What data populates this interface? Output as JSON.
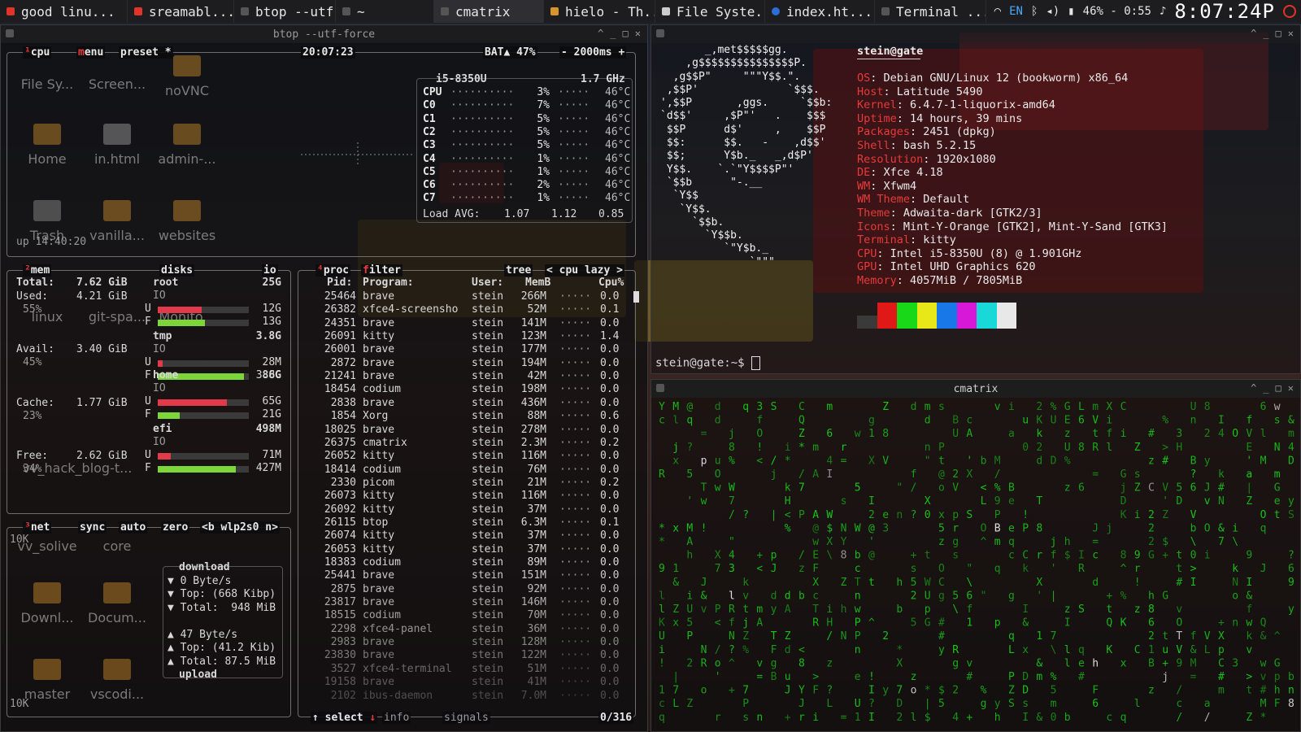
{
  "panel": {
    "tabs": [
      {
        "label": "good linu...",
        "color": "#e0332a"
      },
      {
        "label": "sreamabl...",
        "color": "#e0332a"
      },
      {
        "label": "btop --utf...",
        "color": "#555555"
      },
      {
        "label": "~",
        "color": "#555555"
      },
      {
        "label": "cmatrix",
        "color": "#555555"
      },
      {
        "label": "hielo - Th...",
        "color": "#d8932d"
      },
      {
        "label": "File Syste...",
        "color": "#cccccc"
      },
      {
        "label": "index.ht...",
        "color": "#2b6fd6"
      },
      {
        "label": "Terminal ...",
        "color": "#555555"
      }
    ],
    "keyboard_layout": "EN",
    "battery": "46% - 0:55",
    "clock": "8:07:24P"
  },
  "btop": {
    "window_title": "btop --utf-force",
    "header": {
      "cpu_tab": "cpu",
      "menu": "menu",
      "preset": "preset *",
      "time": "20:07:23",
      "battery": "BAT▲ 47%",
      "interval": "- 2000ms +"
    },
    "cpu": {
      "model": "i5-8350U",
      "freq": "1.7 GHz",
      "rows": [
        {
          "label": "CPU",
          "pct": "3%",
          "temp": "46°C"
        },
        {
          "label": "C0",
          "pct": "7%",
          "temp": "46°C"
        },
        {
          "label": "C1",
          "pct": "5%",
          "temp": "46°C"
        },
        {
          "label": "C2",
          "pct": "5%",
          "temp": "46°C"
        },
        {
          "label": "C3",
          "pct": "5%",
          "temp": "46°C"
        },
        {
          "label": "C4",
          "pct": "1%",
          "temp": "46°C"
        },
        {
          "label": "C5",
          "pct": "1%",
          "temp": "46°C"
        },
        {
          "label": "C6",
          "pct": "2%",
          "temp": "46°C"
        },
        {
          "label": "C7",
          "pct": "1%",
          "temp": "46°C"
        }
      ],
      "load_avg_label": "Load AVG:",
      "load_avg": [
        "1.07",
        "1.12",
        "0.85"
      ],
      "uptime": "up 14:40:20"
    },
    "mem": {
      "title": "mem",
      "disks_title": "disks",
      "io_title": "io",
      "rows": [
        {
          "label": "Total:",
          "value": "7.62 GiB",
          "pct": ""
        },
        {
          "label": "Used:",
          "value": "4.21 GiB",
          "pct": "55%"
        },
        {
          "label": "Avail:",
          "value": "3.40 GiB",
          "pct": "45%"
        },
        {
          "label": "Cache:",
          "value": "1.77 GiB",
          "pct": "23%"
        },
        {
          "label": "Free:",
          "value": "2.62 GiB",
          "pct": "34%"
        }
      ],
      "disks": [
        {
          "name": "root",
          "size": "25G",
          "used": "12G",
          "free": "13G",
          "used_frac": 0.48,
          "free_frac": 0.52
        },
        {
          "name": "tmp",
          "size": "3.8G",
          "used": "28M",
          "free": "3.8G",
          "used_frac": 0.05,
          "free_frac": 0.95
        },
        {
          "name": "home",
          "size": "86G",
          "used": "65G",
          "free": "21G",
          "used_frac": 0.76,
          "free_frac": 0.24
        },
        {
          "name": "efi",
          "size": "498M",
          "used": "71M",
          "free": "427M",
          "used_frac": 0.14,
          "free_frac": 0.86
        }
      ]
    },
    "net": {
      "title": "net",
      "sync": "sync",
      "auto": "auto",
      "zero": "zero",
      "iface": "<b wlp2s0 n>",
      "scale_top": "10K",
      "scale_bottom": "10K",
      "download_label": "download",
      "down_rate": "0 Byte/s",
      "down_top": "Top: (668 Kibp)",
      "down_total": "Total:  948 MiB",
      "up_rate": "47 Byte/s",
      "up_top": "Top: (41.2 Kib)",
      "up_total": "Total: 87.5 MiB",
      "upload_label": "upload"
    },
    "proc": {
      "title": "proc",
      "filter": "filter",
      "tree": "tree",
      "sort": "< cpu lazy >",
      "headers": [
        "Pid:",
        "Program:",
        "User:",
        "MemB",
        "Cpu%"
      ],
      "rows": [
        [
          "25464",
          "brave",
          "stein",
          "266M",
          "0.0"
        ],
        [
          "26382",
          "xfce4-screensho",
          "stein",
          "52M",
          "0.1"
        ],
        [
          "24351",
          "brave",
          "stein",
          "141M",
          "0.0"
        ],
        [
          "26091",
          "kitty",
          "stein",
          "123M",
          "1.4"
        ],
        [
          "26001",
          "brave",
          "stein",
          "177M",
          "0.0"
        ],
        [
          "2872",
          "brave",
          "stein",
          "194M",
          "0.0"
        ],
        [
          "21241",
          "brave",
          "stein",
          "42M",
          "0.0"
        ],
        [
          "18454",
          "codium",
          "stein",
          "198M",
          "0.0"
        ],
        [
          "2838",
          "brave",
          "stein",
          "436M",
          "0.0"
        ],
        [
          "1854",
          "Xorg",
          "stein",
          "88M",
          "0.6"
        ],
        [
          "18025",
          "brave",
          "stein",
          "278M",
          "0.0"
        ],
        [
          "26375",
          "cmatrix",
          "stein",
          "2.3M",
          "0.2"
        ],
        [
          "26052",
          "kitty",
          "stein",
          "116M",
          "0.0"
        ],
        [
          "18414",
          "codium",
          "stein",
          "76M",
          "0.0"
        ],
        [
          "2330",
          "picom",
          "stein",
          "21M",
          "0.2"
        ],
        [
          "26073",
          "kitty",
          "stein",
          "116M",
          "0.0"
        ],
        [
          "26092",
          "kitty",
          "stein",
          "37M",
          "0.0"
        ],
        [
          "26115",
          "btop",
          "stein",
          "6.3M",
          "0.1"
        ],
        [
          "26074",
          "kitty",
          "stein",
          "37M",
          "0.0"
        ],
        [
          "26053",
          "kitty",
          "stein",
          "37M",
          "0.0"
        ],
        [
          "18383",
          "codium",
          "stein",
          "89M",
          "0.0"
        ],
        [
          "25441",
          "brave",
          "stein",
          "151M",
          "0.0"
        ],
        [
          "2875",
          "brave",
          "stein",
          "92M",
          "0.0"
        ],
        [
          "23817",
          "brave",
          "stein",
          "146M",
          "0.0"
        ],
        [
          "18515",
          "codium",
          "stein",
          "70M",
          "0.0"
        ],
        [
          "2298",
          "xfce4-panel",
          "stein",
          "36M",
          "0.0"
        ],
        [
          "2983",
          "brave",
          "stein",
          "128M",
          "0.0"
        ],
        [
          "23830",
          "brave",
          "stein",
          "122M",
          "0.0"
        ],
        [
          "3527",
          "xfce4-terminal",
          "stein",
          "51M",
          "0.0"
        ],
        [
          "19158",
          "brave",
          "stein",
          "41M",
          "0.0"
        ],
        [
          "2102",
          "ibus-daemon",
          "stein",
          "7.0M",
          "0.0"
        ]
      ],
      "footer_select": "select",
      "footer_info": "info",
      "footer_signals": "signals",
      "footer_count": "0/316"
    }
  },
  "desktop_icons": [
    "File Sy...",
    "Screen...",
    "noVNC",
    "Home",
    "in.html",
    "admin-...",
    "Trash",
    "vanilla...",
    "websites",
    "linux",
    "git-spa...",
    "Monito...",
    "vv_solive",
    "core",
    "Downl...",
    "Docum...",
    "master",
    "vscodi...",
    "vv_hack_blog-t..."
  ],
  "kitty": {
    "user_host": "stein@gate",
    "info": [
      {
        "key": "OS",
        "value": "Debian GNU/Linux 12 (bookworm) x86_64"
      },
      {
        "key": "Host",
        "value": "Latitude 5490"
      },
      {
        "key": "Kernel",
        "value": "6.4.7-1-liquorix-amd64"
      },
      {
        "key": "Uptime",
        "value": "14 hours, 39 mins"
      },
      {
        "key": "Packages",
        "value": "2451 (dpkg)"
      },
      {
        "key": "Shell",
        "value": "bash 5.2.15"
      },
      {
        "key": "Resolution",
        "value": "1920x1080"
      },
      {
        "key": "DE",
        "value": "Xfce 4.18"
      },
      {
        "key": "WM",
        "value": "Xfwm4"
      },
      {
        "key": "WM Theme",
        "value": "Default"
      },
      {
        "key": "Theme",
        "value": "Adwaita-dark [GTK2/3]"
      },
      {
        "key": "Icons",
        "value": "Mint-Y-Orange [GTK2], Mint-Y-Sand [GTK3]"
      },
      {
        "key": "Terminal",
        "value": "kitty"
      },
      {
        "key": "CPU",
        "value": "Intel i5-8350U (8) @ 1.901GHz"
      },
      {
        "key": "GPU",
        "value": "Intel UHD Graphics 620"
      },
      {
        "key": "Memory",
        "value": "4057MiB / 7805MiB"
      }
    ],
    "palette": [
      "#3a3a3a",
      "#e01818",
      "#18d818",
      "#e8e818",
      "#1878e8",
      "#d818d8",
      "#18d8d8",
      "#e8e8e8"
    ],
    "prompt": "stein@gate:~$ "
  },
  "cmatrix": {
    "window_title": "cmatrix",
    "glyph_color": "#18c818"
  }
}
